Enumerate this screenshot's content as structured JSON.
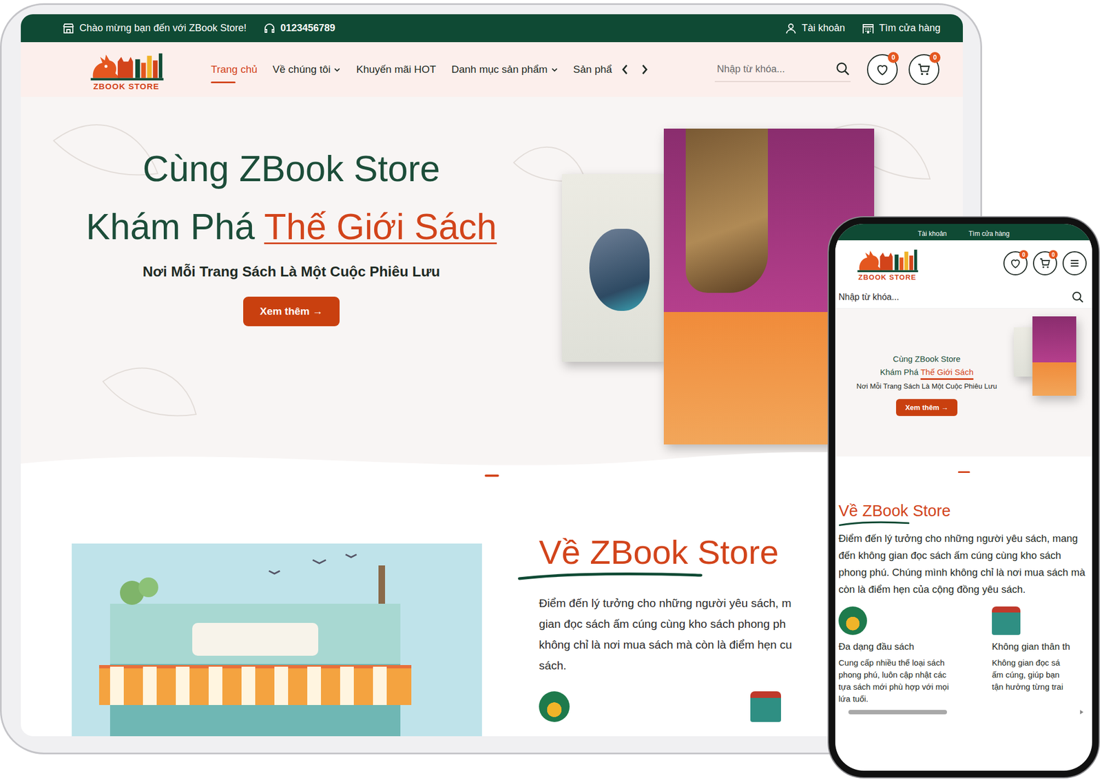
{
  "tablet": {
    "topbar": {
      "welcome": "Chào mừng bạn đến với ZBook Store!",
      "phone": "0123456789",
      "account": "Tài khoản",
      "store_finder": "Tìm cửa hàng"
    },
    "logo": "ZBOOK STORE",
    "nav": [
      {
        "label": "Trang chủ",
        "selected": true,
        "dropdown": false
      },
      {
        "label": "Về chúng tôi",
        "selected": false,
        "dropdown": true
      },
      {
        "label": "Khuyến mãi HOT",
        "selected": false,
        "dropdown": false
      },
      {
        "label": "Danh mục sản phẩm",
        "selected": false,
        "dropdown": true
      },
      {
        "label": "Sản phẩ",
        "selected": false,
        "dropdown": false
      }
    ],
    "search": {
      "placeholder": "Nhập từ khóa..."
    },
    "wishlist_count": "0",
    "cart_count": "0",
    "hero": {
      "title": "Cùng ZBook Store",
      "title_prefix": "Khám Phá",
      "title_highlight": "Thế Giới Sách",
      "subtitle": "Nơi Mỗi Trang Sách Là Một Cuộc Phiêu Lưu",
      "button": "Xem thêm →"
    },
    "slides": [
      {
        "selected": true
      }
    ],
    "about": {
      "title_underlined": "Về ZBook",
      "title_rest": "Store",
      "paragraph_lines": [
        "Điểm đến lý tưởng cho những người yêu sách, m",
        "gian đọc sách ấm cúng cùng kho sách phong ph",
        "không chỉ là nơi mua sách mà còn là điểm hẹn cu",
        "sách."
      ]
    }
  },
  "phone": {
    "topbar": {
      "account": "Tài khoản",
      "store_finder": "Tìm cửa hàng"
    },
    "logo": "ZBOOK STORE",
    "wishlist_count": "0",
    "cart_count": "0",
    "search": {
      "placeholder": "Nhập từ khóa..."
    },
    "hero": {
      "title": "Cùng ZBook Store",
      "title_prefix": "Khám Phá",
      "title_highlight": "Thế Giới Sách",
      "subtitle": "Nơi Mỗi Trang Sách Là Một Cuộc Phiêu Lưu",
      "button": "Xem thêm →"
    },
    "slides": [
      {
        "selected": true
      }
    ],
    "about": {
      "title": "Về ZBook Store",
      "paragraph": "Điểm đến lý tưởng cho những người yêu sách, mang đến không gian đọc sách ấm cúng cùng kho sách phong phú. Chúng mình không chỉ là nơi mua sách mà còn là điểm hẹn của cộng đồng yêu sách.",
      "features": [
        {
          "title": "Đa dạng đầu sách",
          "description_lines": [
            "Cung cấp nhiều thể loại sách",
            "phong phú, luôn cập nhật các",
            "tựa sách mới phù hợp với mọi",
            "lứa tuổi."
          ]
        },
        {
          "title": "Không gian thân th",
          "description_lines": [
            "Không gian đọc sá",
            "ấm cúng, giúp bạn",
            "tận hưởng từng trai"
          ]
        }
      ]
    }
  }
}
